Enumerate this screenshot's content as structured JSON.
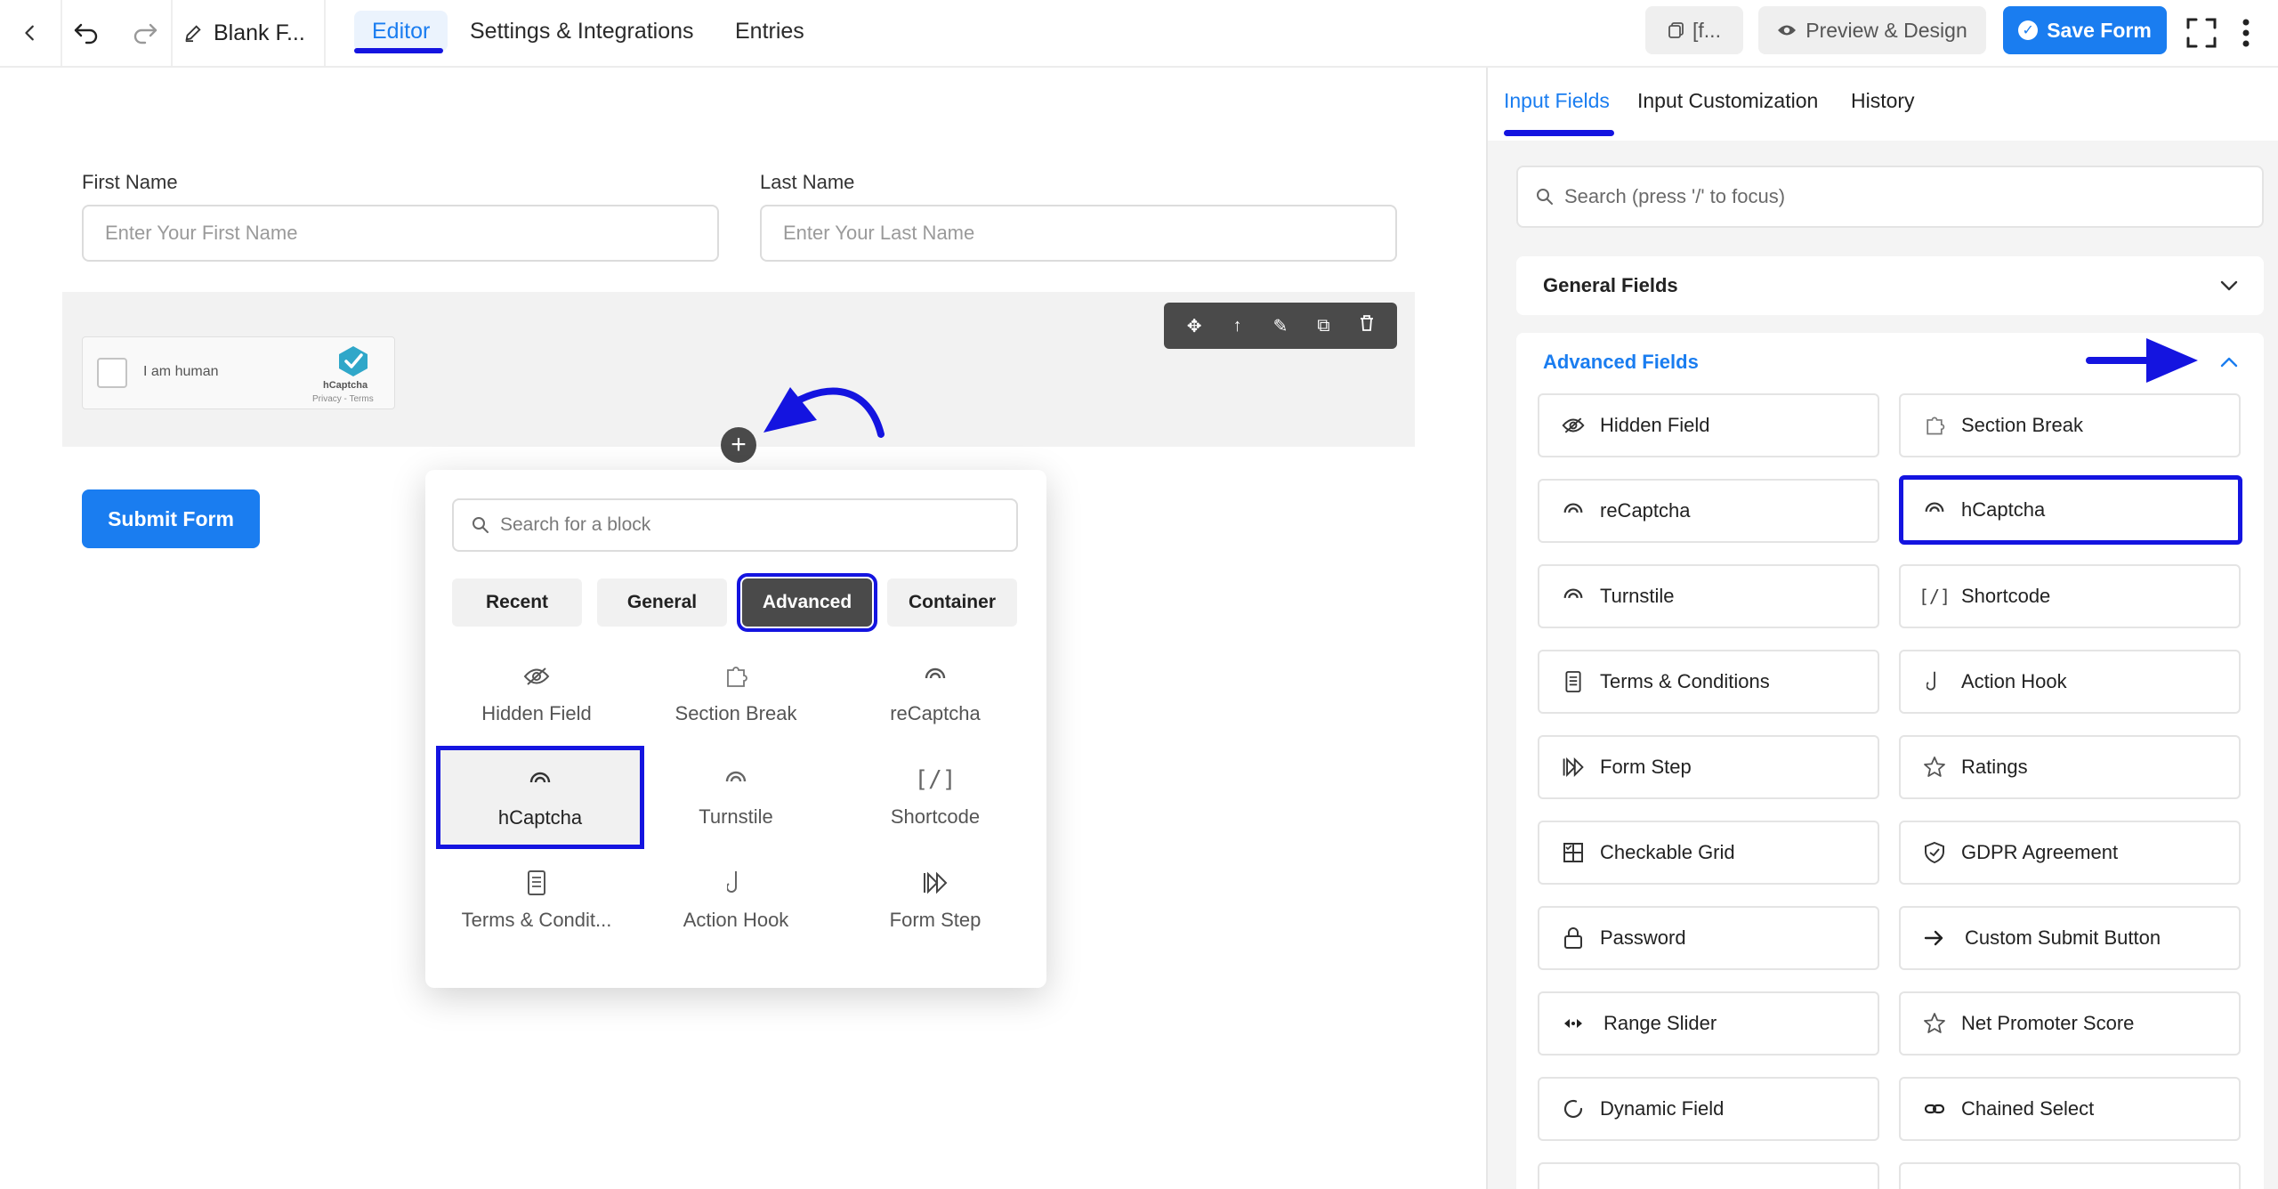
{
  "topbar": {
    "doc_title": "Blank F...",
    "tabs": [
      {
        "label": "Editor"
      },
      {
        "label": "Settings & Integrations"
      },
      {
        "label": "Entries"
      }
    ],
    "shortcode_label": "[f...",
    "preview_label": "Preview & Design",
    "save_label": "Save Form"
  },
  "form": {
    "first_name": {
      "label": "First Name",
      "placeholder": "Enter Your First Name"
    },
    "last_name": {
      "label": "Last Name",
      "placeholder": "Enter Your Last Name"
    },
    "captcha": {
      "text": "I am human",
      "brand": "hCaptcha",
      "links": "Privacy - Terms"
    },
    "submit_label": "Submit Form"
  },
  "inserter": {
    "search_placeholder": "Search for a block",
    "categories": [
      {
        "label": "Recent"
      },
      {
        "label": "General"
      },
      {
        "label": "Advanced"
      },
      {
        "label": "Container"
      }
    ],
    "active_category": "Advanced",
    "blocks": [
      {
        "label": "Hidden Field",
        "icon": "eye-slash-icon"
      },
      {
        "label": "Section Break",
        "icon": "puzzle-icon"
      },
      {
        "label": "reCaptcha",
        "icon": "captcha-icon"
      },
      {
        "label": "hCaptcha",
        "icon": "captcha-icon"
      },
      {
        "label": "Turnstile",
        "icon": "captcha-icon"
      },
      {
        "label": "Shortcode",
        "icon": "shortcode-icon"
      },
      {
        "label": "Terms & Condit...",
        "icon": "document-icon"
      },
      {
        "label": "Action Hook",
        "icon": "hook-icon"
      },
      {
        "label": "Form Step",
        "icon": "step-icon"
      }
    ],
    "selected_block": "hCaptcha"
  },
  "panel": {
    "tabs": [
      {
        "label": "Input Fields"
      },
      {
        "label": "Input Customization"
      },
      {
        "label": "History"
      }
    ],
    "search_placeholder": "Search (press '/' to focus)",
    "general_title": "General Fields",
    "advanced_title": "Advanced Fields",
    "advanced_fields": [
      {
        "label": "Hidden Field",
        "icon": "eye-slash-icon"
      },
      {
        "label": "Section Break",
        "icon": "puzzle-icon"
      },
      {
        "label": "reCaptcha",
        "icon": "captcha-icon"
      },
      {
        "label": "hCaptcha",
        "icon": "captcha-icon"
      },
      {
        "label": "Turnstile",
        "icon": "captcha-icon"
      },
      {
        "label": "Shortcode",
        "icon": "shortcode-icon"
      },
      {
        "label": "Terms & Conditions",
        "icon": "document-icon"
      },
      {
        "label": "Action Hook",
        "icon": "hook-icon"
      },
      {
        "label": "Form Step",
        "icon": "step-icon"
      },
      {
        "label": "Ratings",
        "icon": "star-icon"
      },
      {
        "label": "Checkable Grid",
        "icon": "grid-icon"
      },
      {
        "label": "GDPR Agreement",
        "icon": "shield-icon"
      },
      {
        "label": "Password",
        "icon": "lock-icon"
      },
      {
        "label": "Custom Submit Button",
        "icon": "arrow-right-icon"
      },
      {
        "label": "Range Slider",
        "icon": "range-icon"
      },
      {
        "label": "Net Promoter Score",
        "icon": "star-icon"
      },
      {
        "label": "Dynamic Field",
        "icon": "refresh-icon"
      },
      {
        "label": "Chained Select",
        "icon": "link-icon"
      }
    ],
    "highlighted_field": "hCaptcha"
  },
  "colors": {
    "accent": "#1a7df0",
    "annotation": "#1414e0",
    "toolbar_dark": "#4a4a4a"
  }
}
